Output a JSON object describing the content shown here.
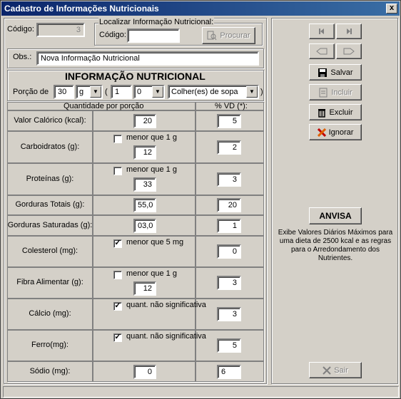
{
  "window": {
    "title": "Cadastro de Informações Nutricionais",
    "close_glyph": "x"
  },
  "codigo": {
    "label": "Código:",
    "value": "3"
  },
  "localizar": {
    "group_label": "Localizar Informação Nutricional:",
    "label": "Código:",
    "value": "",
    "button": "Procurar"
  },
  "obs": {
    "label": "Obs.:",
    "value": "Nova Informação Nutricional"
  },
  "info": {
    "heading": "INFORMAÇÃO NUTRICIONAL",
    "porcao_label": "Porção de",
    "porcao_value": "30",
    "unit": "g",
    "paren_open": "(",
    "qty_int": "1",
    "qty_frac": "0",
    "medida": "Colher(es) de sopa",
    "paren_close": ")"
  },
  "table": {
    "col_qty": "Quantidade por porção",
    "col_vd": "% VD (*):",
    "rows": [
      {
        "label": "Valor Calórico (kcal):",
        "value": "20",
        "vd": "5",
        "check": null
      },
      {
        "label": "Carboidratos (g):",
        "value": "12",
        "vd": "2",
        "check": {
          "text": "menor que 1 g",
          "checked": false
        }
      },
      {
        "label": "Proteínas (g):",
        "value": "33",
        "vd": "3",
        "check": {
          "text": "menor que 1 g",
          "checked": false
        }
      },
      {
        "label": "Gorduras Totais (g):",
        "value": "55,0",
        "vd": "20",
        "check": null
      },
      {
        "label": "Gorduras Saturadas (g):",
        "value": "03,0",
        "vd": "1",
        "check": null
      },
      {
        "label": "Colesterol (mg):",
        "value": "",
        "vd": "0",
        "check": {
          "text": "menor que 5 mg",
          "checked": true
        }
      },
      {
        "label": "Fibra Alimentar (g):",
        "value": "12",
        "vd": "3",
        "check": {
          "text": "menor que 1 g",
          "checked": false
        }
      },
      {
        "label": "Cálcio (mg):",
        "value": "",
        "vd": "3",
        "check": {
          "text": "quant. não significativa",
          "checked": true
        }
      },
      {
        "label": "Ferro(mg):",
        "value": "",
        "vd": "5",
        "check": {
          "text": "quant. não significativa",
          "checked": true
        }
      },
      {
        "label": "Sódio (mg):",
        "value": "0",
        "vd": "6",
        "check": null
      }
    ]
  },
  "buttons": {
    "salvar": "Salvar",
    "incluir": "Incluir",
    "excluir": "Excluir",
    "ignorar": "Ignorar",
    "anvisa": "ANVISA",
    "sair": "Sair"
  },
  "anvisa_text": "Exibe Valores Diários Máximos para uma dieta de 2500 kcal e as regras para o Arredondamento dos Nutrientes.",
  "check_glyph": "✓"
}
